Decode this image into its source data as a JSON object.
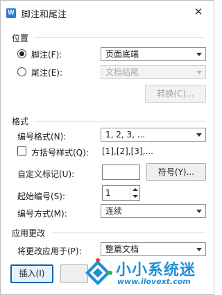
{
  "window": {
    "title": "脚注和尾注",
    "app_icon": "W"
  },
  "location": {
    "section_label": "位置",
    "footnote": {
      "label": "脚注(F):",
      "checked": true,
      "value": "页面底端"
    },
    "endnote": {
      "label": "尾注(E):",
      "checked": false,
      "value": "文档结尾"
    },
    "convert_button": "转换(C)..."
  },
  "format": {
    "section_label": "格式",
    "number_format": {
      "label": "编号格式(N):",
      "value": "1, 2, 3, ..."
    },
    "bracket_style": {
      "label": "方括号样式(Q):",
      "checked": false,
      "example": "[1],[2],[3],..."
    },
    "custom_mark": {
      "label": "自定义标记(U):",
      "value": "",
      "symbol_button": "符号(Y)..."
    },
    "start_at": {
      "label": "起始编号(S):",
      "value": "1"
    },
    "numbering": {
      "label": "编号方式(M):",
      "value": "连续"
    }
  },
  "apply": {
    "section_label": "应用更改",
    "apply_to": {
      "label": "将更改应用于(P):",
      "value": "整篇文档"
    }
  },
  "buttons": {
    "insert": "插入(I)"
  },
  "watermark": {
    "brand": "小小系统迷",
    "url": "www.ilovext.com"
  }
}
